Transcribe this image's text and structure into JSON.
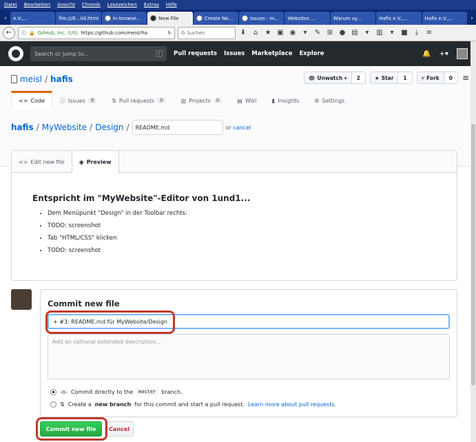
{
  "menubar": [
    "Datei",
    "Bearbeiten",
    "Ansicht",
    "Chronik",
    "Lesezeichen",
    "Extras",
    "Hilfe"
  ],
  "tabs": [
    {
      "label": "e.V.,...",
      "active": false
    },
    {
      "label": "file:///E...ild.html",
      "active": false
    },
    {
      "label": "In-browse...",
      "active": false
    },
    {
      "label": "New File",
      "active": true
    },
    {
      "label": "Create Ne...",
      "active": false
    },
    {
      "label": "Issues · m...",
      "active": false
    },
    {
      "label": "Websites ...",
      "active": false
    },
    {
      "label": "Warum sy...",
      "active": false
    },
    {
      "label": "Hafis e.V.,...",
      "active": false
    },
    {
      "label": "Hafis e.V.,...",
      "active": false
    }
  ],
  "browser": {
    "secure_label": "GitHub, Inc. (US)",
    "url": "https://github.com/meisl/ha",
    "search_placeholder": "Suchen"
  },
  "github": {
    "search_placeholder": "Search or jump to...",
    "search_key": "/",
    "nav": [
      "Pull requests",
      "Issues",
      "Marketplace",
      "Explore"
    ]
  },
  "repo": {
    "owner": "meisl",
    "name": "hafis",
    "watch_label": "Unwatch ▾",
    "watch_count": "2",
    "star_label": "Star",
    "star_count": "1",
    "fork_label": "Fork",
    "fork_count": "0",
    "tabs": [
      {
        "label": "Code",
        "count": null
      },
      {
        "label": "Issues",
        "count": "9"
      },
      {
        "label": "Pull requests",
        "count": "0"
      },
      {
        "label": "Projects",
        "count": "0"
      },
      {
        "label": "Wiki",
        "count": null
      },
      {
        "label": "Insights",
        "count": null
      },
      {
        "label": "Settings",
        "count": null
      }
    ]
  },
  "breadcrumb": {
    "root": "hafis",
    "dir1": "MyWebsite",
    "dir2": "Design",
    "filename": "README.md",
    "or_text": "or",
    "cancel_link": "cancel"
  },
  "editor": {
    "tab_edit": "Edit new file",
    "tab_preview": "Preview",
    "heading": "Entspricht im \"MyWebsite\"-Editor von 1und1...",
    "items": [
      "Dem Menüpunkt \"Design\" in der Toolbar rechts:",
      "TODO: screenshot",
      "Tab \"HTML/CSS\" klicken",
      "TODO: screenshot"
    ]
  },
  "commit": {
    "title": "Commit new file",
    "message": "+ #3: README.md für MyWebsite/Design",
    "description_placeholder": "Add an optional extended description...",
    "opt1_pre": "Commit directly to the",
    "opt1_branch": "master",
    "opt1_post": "branch.",
    "opt2_pre": "Create a",
    "opt2_bold": "new branch",
    "opt2_mid": "for this commit and start a pull request.",
    "opt2_link": "Learn more about pull requests.",
    "submit_label": "Commit new file",
    "cancel_label": "Cancel"
  },
  "colors": {
    "highlight": "#c0392b",
    "green": "#28a745",
    "link": "#0366d6",
    "header": "#24292e"
  }
}
